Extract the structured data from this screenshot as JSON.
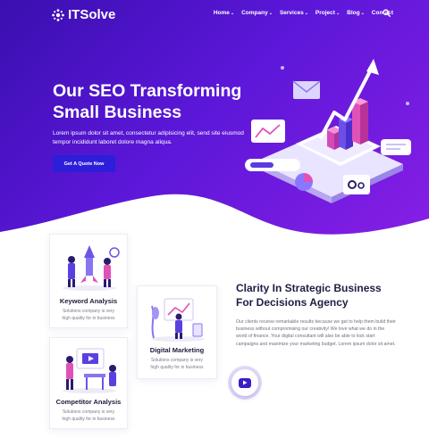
{
  "brand": {
    "name": "ITSolve"
  },
  "nav": {
    "items": [
      {
        "label": "Home",
        "dropdown": true
      },
      {
        "label": "Company",
        "dropdown": true
      },
      {
        "label": "Services",
        "dropdown": true
      },
      {
        "label": "Project",
        "dropdown": true
      },
      {
        "label": "Blog",
        "dropdown": true
      },
      {
        "label": "Contact",
        "dropdown": false
      }
    ],
    "chevron": "⌄"
  },
  "hero": {
    "title_line1": "Our SEO Transforming",
    "title_line2": "Small Business",
    "subtitle": "Lorem ipsum dolor sit amet, consectetur adipisicing elit, send site eiusmod tempor incididunt laboret dolore magna aliqua.",
    "cta_label": "Get A Quote Now"
  },
  "cards": [
    {
      "title": "Keyword Analysis",
      "text": "Solutions company is very high quality for in business"
    },
    {
      "title": "Digital Marketing",
      "text": "Solutions company is very high quality for in business"
    },
    {
      "title": "Competitor Analysis",
      "text": "Solutions company is very high quality for in business"
    }
  ],
  "about": {
    "title_line1": "Clarity In Strategic Business",
    "title_line2": "For Decisions Agency",
    "text": "Our clients receive remarkable results because we get to help them build their business without compromising our creativity! We love what we do in the world of finance. Your digital consultant will also be able to kick start campaigns and maximize your marketing budget. Lorem ipsum dolor sit amet."
  },
  "colors": {
    "hero_start": "#3a0fb0",
    "hero_end": "#8a1fe6",
    "cta": "#2c1ed9",
    "heading": "#1e1e46"
  }
}
